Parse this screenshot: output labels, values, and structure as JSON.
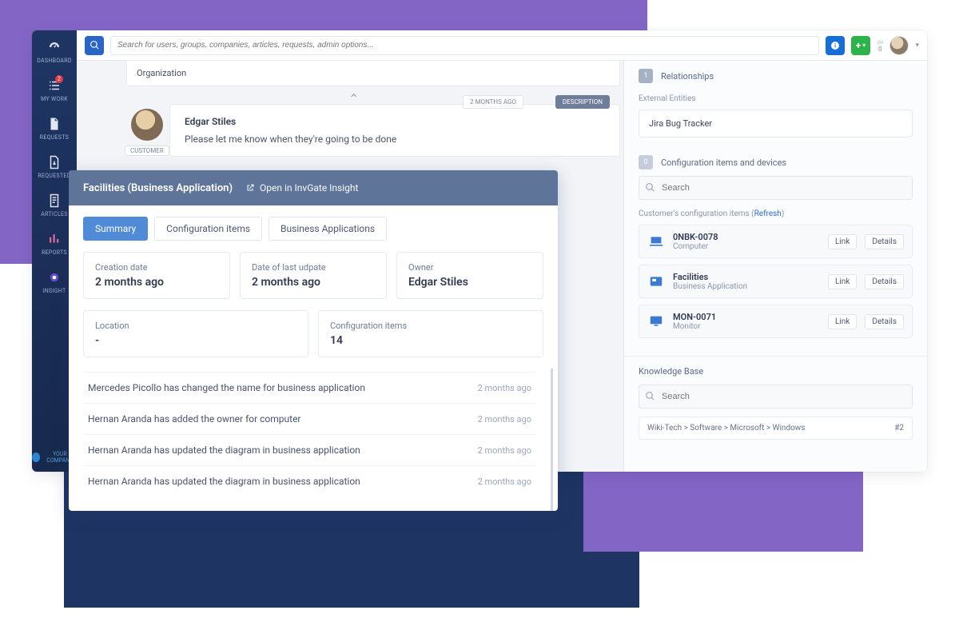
{
  "sidebar": {
    "items": [
      {
        "label": "DASHBOARD"
      },
      {
        "label": "MY WORK",
        "badge": "2"
      },
      {
        "label": "REQUESTS"
      },
      {
        "label": "REQUESTED"
      },
      {
        "label": "ARTICLES"
      },
      {
        "label": "REPORTS"
      },
      {
        "label": "INSIGHT"
      }
    ],
    "company": "YOUR COMPANY"
  },
  "topbar": {
    "search_placeholder": "Search for users, groups, companies, articles, requests, admin options...",
    "notif_count": "0"
  },
  "breadcrumb": {
    "label": "Organization"
  },
  "comment": {
    "author": "Edgar Stiles",
    "role": "CUSTOMER",
    "message": "Please let me know when they're going to be done",
    "time": "2 MONTHS AGO",
    "tag": "DESCRIPTION"
  },
  "facilities": {
    "title": "Facilities (Business Application)",
    "open_label": "Open in InvGate Insight",
    "tabs": [
      "Summary",
      "Configuration items",
      "Business Applications"
    ],
    "summary": [
      {
        "label": "Creation date",
        "value": "2 months ago"
      },
      {
        "label": "Date of last udpate",
        "value": "2 months ago"
      },
      {
        "label": "Owner",
        "value": "Edgar Stiles"
      }
    ],
    "summary2": [
      {
        "label": "Location",
        "value": "-"
      },
      {
        "label": "Configuration items",
        "value": "14"
      }
    ],
    "activity": [
      {
        "text": "Mercedes Picollo has changed the name for business application",
        "time": "2 months ago"
      },
      {
        "text": "Hernan Aranda has added the owner for computer",
        "time": "2 months ago"
      },
      {
        "text": "Hernan Aranda has updated the diagram in business application",
        "time": "2 months ago"
      },
      {
        "text": "Hernan Aranda has updated the diagram in business application",
        "time": "2 months ago"
      }
    ]
  },
  "right": {
    "rel_count": "1",
    "rel_title": "Relationships",
    "ext_title": "External Entities",
    "ext_item": "Jira Bug Tracker",
    "ci_count": "0",
    "ci_title": "Configuration items and devices",
    "search_placeholder": "Search",
    "refresh_label": "Customer's configuration items (",
    "refresh_link": "Refresh",
    "ci": [
      {
        "name": "0NBK-0078",
        "type": "Computer",
        "icon": "laptop"
      },
      {
        "name": "Facilities",
        "type": "Business Application",
        "icon": "app"
      },
      {
        "name": "MON-0071",
        "type": "Monitor",
        "icon": "monitor"
      }
    ],
    "link_label": "Link",
    "details_label": "Details",
    "kb_title": "Knowledge Base",
    "kb_search_placeholder": "Search",
    "kb_row": "Wiki-Tech > Software > Microsoft > Windows",
    "kb_tag": "#2"
  }
}
